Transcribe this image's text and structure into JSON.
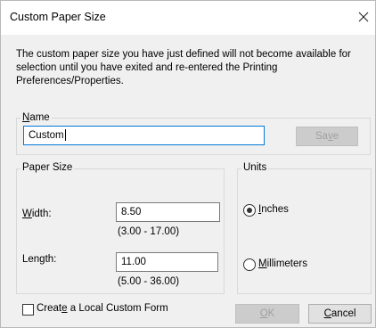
{
  "window": {
    "title": "Custom Paper Size"
  },
  "info_text_line1": "The custom paper size you have just defined will not become available for",
  "info_text_line2": "selection until you have exited and re-entered the Printing Preferences/Properties.",
  "name_group": {
    "label_pre": "",
    "label_mnemonic": "N",
    "label_post": "ame",
    "value": "Custom",
    "save_pre": "Sa",
    "save_mnemonic": "v",
    "save_post": "e"
  },
  "paper_size": {
    "label": "Paper Size",
    "width_pre": "",
    "width_mnemonic": "W",
    "width_post": "idth:",
    "width_value": "8.50",
    "width_range": "(3.00 - 17.00)",
    "length_label": "Length:",
    "length_value": "11.00",
    "length_range": "(5.00 - 36.00)"
  },
  "units": {
    "label": "Units",
    "inches_mnemonic": "I",
    "inches_post": "nches",
    "inches_selected": true,
    "mm_mnemonic": "M",
    "mm_post": "illimeters"
  },
  "local_form": {
    "pre": "Creat",
    "mnemonic": "e",
    "post": " a Local Custom Form",
    "checked": false
  },
  "buttons": {
    "ok_mnemonic": "O",
    "ok_post": "K",
    "cancel_mnemonic": "C",
    "cancel_post": "ancel"
  },
  "icons": {
    "close": "close-icon"
  },
  "colors": {
    "focus": "#0078d7",
    "dialog_bg": "#f0f0f0"
  }
}
